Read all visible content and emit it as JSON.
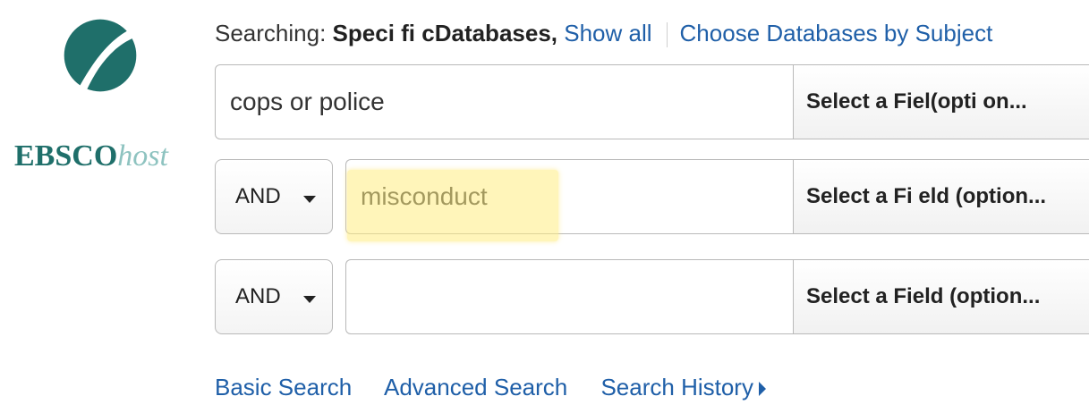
{
  "logo": {
    "brand_main": "EBSCO",
    "brand_sub": "host",
    "colors": {
      "primary": "#1f6f6a",
      "secondary": "#8ec3c0"
    }
  },
  "searching": {
    "prefix": "Searching:",
    "database_text": "Speci fi cDatabases,",
    "show_all": "Show all",
    "choose_by_subject": "Choose Databases by Subject"
  },
  "rows": [
    {
      "operator": "",
      "search_value": "cops or police",
      "field_label": "Select a   Fiel(opti on..."
    },
    {
      "operator": "AND",
      "search_value": "misconduct",
      "field_label": "Select a Fi eld (option..."
    },
    {
      "operator": "AND",
      "search_value": "",
      "field_label": "Select a Field (option..."
    }
  ],
  "bottom_links": {
    "basic": "Basic Search",
    "advanced": "Advanced Search",
    "history": "Search History"
  },
  "colors": {
    "link": "#1f5fa8",
    "highlight": "#ffec82",
    "border": "#b9b9b9"
  }
}
